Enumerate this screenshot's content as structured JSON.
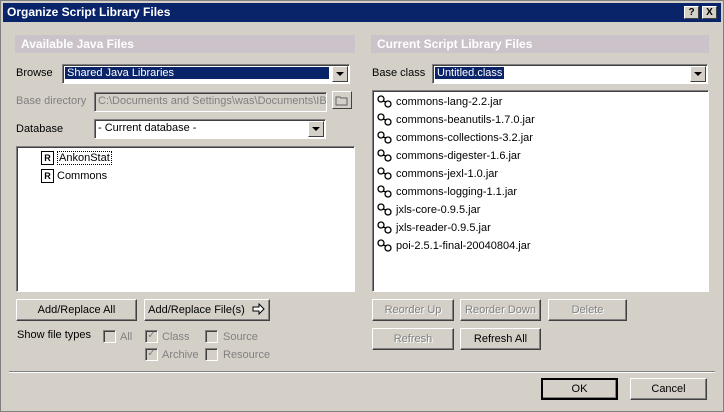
{
  "window": {
    "title": "Organize Script Library Files",
    "help_label": "?",
    "close_label": "X"
  },
  "left": {
    "header": "Available Java Files",
    "browse_label": "Browse",
    "browse_value": "Shared Java Libraries",
    "basedir_label": "Base directory",
    "basedir_value": "C:\\Documents and Settings\\was\\Documents\\IB",
    "database_label": "Database",
    "database_value": "- Current database -",
    "tree": [
      {
        "label": "AnkonStat",
        "selected": true
      },
      {
        "label": "Commons",
        "selected": false
      }
    ],
    "add_replace_all": "Add/Replace All",
    "add_replace_files": "Add/Replace File(s)",
    "show_file_types_label": "Show file types",
    "types": {
      "all": {
        "label": "All",
        "checked": false
      },
      "class": {
        "label": "Class",
        "checked": true
      },
      "source": {
        "label": "Source",
        "checked": false
      },
      "archive": {
        "label": "Archive",
        "checked": true
      },
      "resource": {
        "label": "Resource",
        "checked": false
      }
    }
  },
  "right": {
    "header": "Current Script Library Files",
    "baseclass_label": "Base class",
    "baseclass_value": "Untitled.class",
    "files": [
      "commons-lang-2.2.jar",
      "commons-beanutils-1.7.0.jar",
      "commons-collections-3.2.jar",
      "commons-digester-1.6.jar",
      "commons-jexl-1.0.jar",
      "commons-logging-1.1.jar",
      "jxls-core-0.9.5.jar",
      "jxls-reader-0.9.5.jar",
      "poi-2.5.1-final-20040804.jar"
    ],
    "reorder_up": "Reorder Up",
    "reorder_down": "Reorder Down",
    "delete": "Delete",
    "refresh": "Refresh",
    "refresh_all": "Refresh All"
  },
  "footer": {
    "ok": "OK",
    "cancel": "Cancel"
  },
  "colors": {
    "titlebar": "#0a246a",
    "section_header": "#cbc3c9",
    "face": "#d4d0c8"
  }
}
